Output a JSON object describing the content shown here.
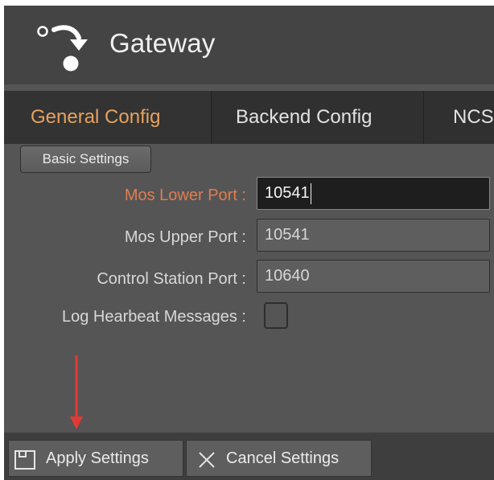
{
  "app": {
    "title": "Gateway",
    "logo_icon": "gateway-logo-icon"
  },
  "tabs": [
    {
      "label": "General Config",
      "active": true
    },
    {
      "label": "Backend Config",
      "active": false
    },
    {
      "label": "NCS",
      "active": false
    }
  ],
  "section": {
    "label": "Basic Settings"
  },
  "fields": {
    "mos_lower_port": {
      "label": "Mos Lower Port :",
      "value": "10541",
      "focused": true
    },
    "mos_upper_port": {
      "label": "Mos Upper Port :",
      "value": "10541"
    },
    "control_station_port": {
      "label": "Control Station Port :",
      "value": "10640"
    },
    "log_heartbeat": {
      "label": "Log Hearbeat Messages :",
      "checked": false
    }
  },
  "footer": {
    "apply_label": "Apply Settings",
    "apply_icon": "save-icon",
    "cancel_label": "Cancel Settings",
    "cancel_icon": "close-icon"
  },
  "colors": {
    "accent": "#e7a15d",
    "focused_label": "#e07d50",
    "annotation_arrow": "#e53935"
  }
}
